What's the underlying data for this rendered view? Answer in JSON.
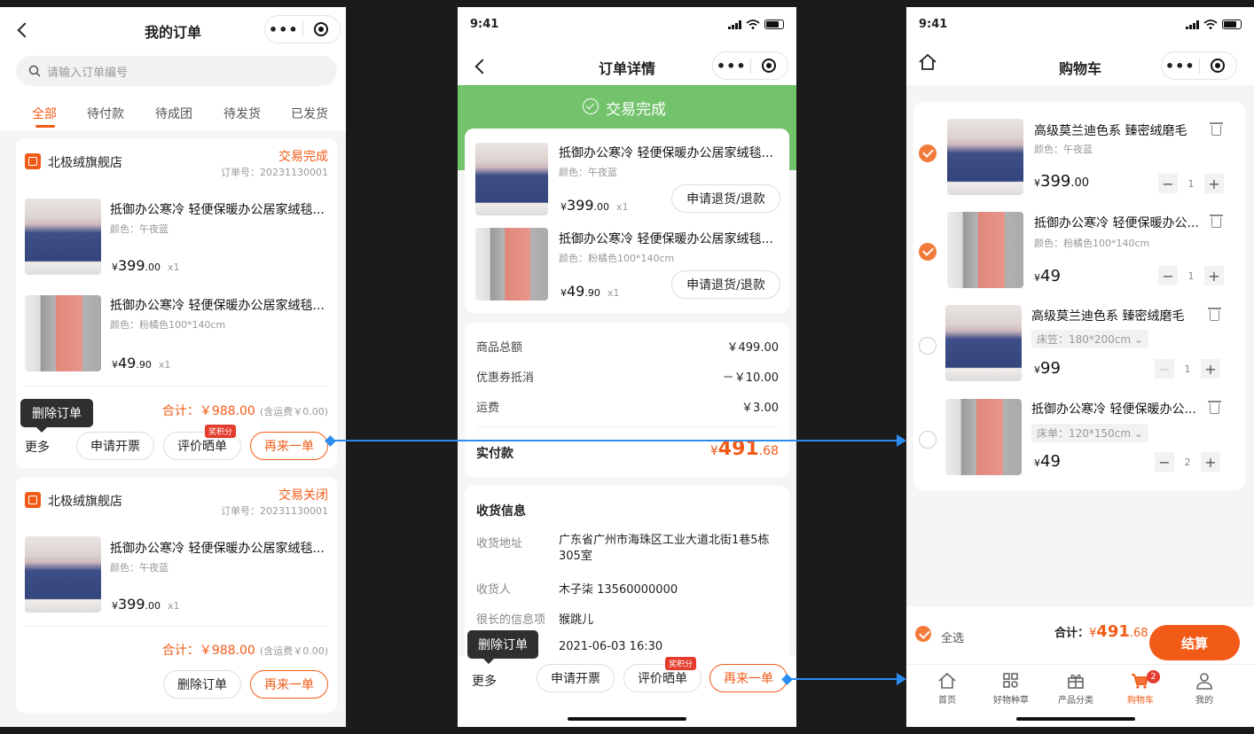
{
  "status_time": "9:41",
  "order_list": {
    "title": "我的订单",
    "search_placeholder": "请输入订单编号",
    "tabs": [
      "全部",
      "待付款",
      "待成团",
      "待发货",
      "已发货"
    ],
    "orders": [
      {
        "shop": "北极绒旗舰店",
        "status": "交易完成",
        "order_no": "订单号：20231130001",
        "items": [
          {
            "name": "抵御办公寒冷 轻便保暖办公居家绒毯...",
            "spec": "颜色：午夜蓝",
            "price_int": "399",
            "price_dec": ".00",
            "qty": "x1"
          },
          {
            "name": "抵御办公寒冷 轻便保暖办公居家绒毯...",
            "spec": "颜色：粉橘色100*140cm",
            "price_int": "49",
            "price_dec": ".90",
            "qty": "x1"
          }
        ],
        "total": "合计：￥988.00",
        "shipping": "(含运费￥0.00)",
        "tooltip": "删除订单",
        "more": "更多",
        "buttons": [
          "申请开票",
          "评价晒单",
          "再来一单"
        ],
        "badge": "奖积分"
      },
      {
        "shop": "北极绒旗舰店",
        "status": "交易关闭",
        "order_no": "订单号：20231130001",
        "items": [
          {
            "name": "抵御办公寒冷 轻便保暖办公居家绒毯...",
            "spec": "颜色：午夜蓝",
            "price_int": "399",
            "price_dec": ".00",
            "qty": "x1"
          }
        ],
        "total": "合计：￥988.00",
        "shipping": "(含运费￥0.00)",
        "buttons": [
          "删除订单",
          "再来一单"
        ]
      }
    ]
  },
  "order_detail": {
    "title": "订单详情",
    "banner": "交易完成",
    "items": [
      {
        "name": "抵御办公寒冷 轻便保暖办公居家绒毯...",
        "spec": "颜色：午夜蓝",
        "price_int": "399",
        "price_dec": ".00",
        "qty": "x1",
        "action": "申请退货/退款"
      },
      {
        "name": "抵御办公寒冷 轻便保暖办公居家绒毯...",
        "spec": "颜色：粉橘色100*140cm",
        "price_int": "49",
        "price_dec": ".90",
        "qty": "x1",
        "action": "申请退货/退款"
      }
    ],
    "summary": [
      {
        "label": "商品总额",
        "value": "￥499.00"
      },
      {
        "label": "优惠券抵消",
        "value": "－￥10.00"
      },
      {
        "label": "运费",
        "value": "￥3.00"
      }
    ],
    "paid_label": "实付款",
    "paid_int": "491",
    "paid_dec": ".68",
    "shipping_title": "收货信息",
    "shipping_rows": [
      {
        "label": "收货地址",
        "value": "广东省广州市海珠区工业大道北街1巷5栋305室"
      },
      {
        "label": "收货人",
        "value": "木子柒  13560000000"
      },
      {
        "label": "很长的信息项",
        "value": "猴跳儿"
      },
      {
        "label": "",
        "value": "2021-06-03 16:30"
      }
    ],
    "tooltip": "删除订单",
    "more": "更多",
    "buttons": [
      "申请开票",
      "评价晒单",
      "再来一单"
    ],
    "badge": "奖积分"
  },
  "cart": {
    "title": "购物车",
    "items": [
      {
        "name": "高级莫兰迪色系   臻密绒磨毛",
        "spec": "颜色：午夜蓝",
        "price_int": "399",
        "price_dec": ".00",
        "qty": "1"
      },
      {
        "name": "抵御办公寒冷 轻便保暖办公...",
        "spec": "颜色：粉橘色100*140cm",
        "price_int": "49",
        "price_dec": "",
        "qty": "1"
      },
      {
        "name": "高级莫兰迪色系   臻密绒磨毛",
        "spec": "床笠：180*200cm ⌄",
        "price_int": "99",
        "price_dec": "",
        "qty": "1"
      },
      {
        "name": "抵御办公寒冷 轻便保暖办公...",
        "spec": "床单：120*150cm ⌄",
        "price_int": "49",
        "price_dec": "",
        "qty": "2"
      }
    ],
    "select_all": "全选",
    "total_label": "合计：",
    "total_int": "491",
    "total_dec": ".68",
    "checkout": "结算",
    "tabbar": [
      "首页",
      "好物种草",
      "产品分类",
      "购物车",
      "我的"
    ],
    "cart_count": "2"
  },
  "colors": {
    "accent": "#f25b17",
    "banner": "#72c36b",
    "connector": "#2b8cf0"
  }
}
